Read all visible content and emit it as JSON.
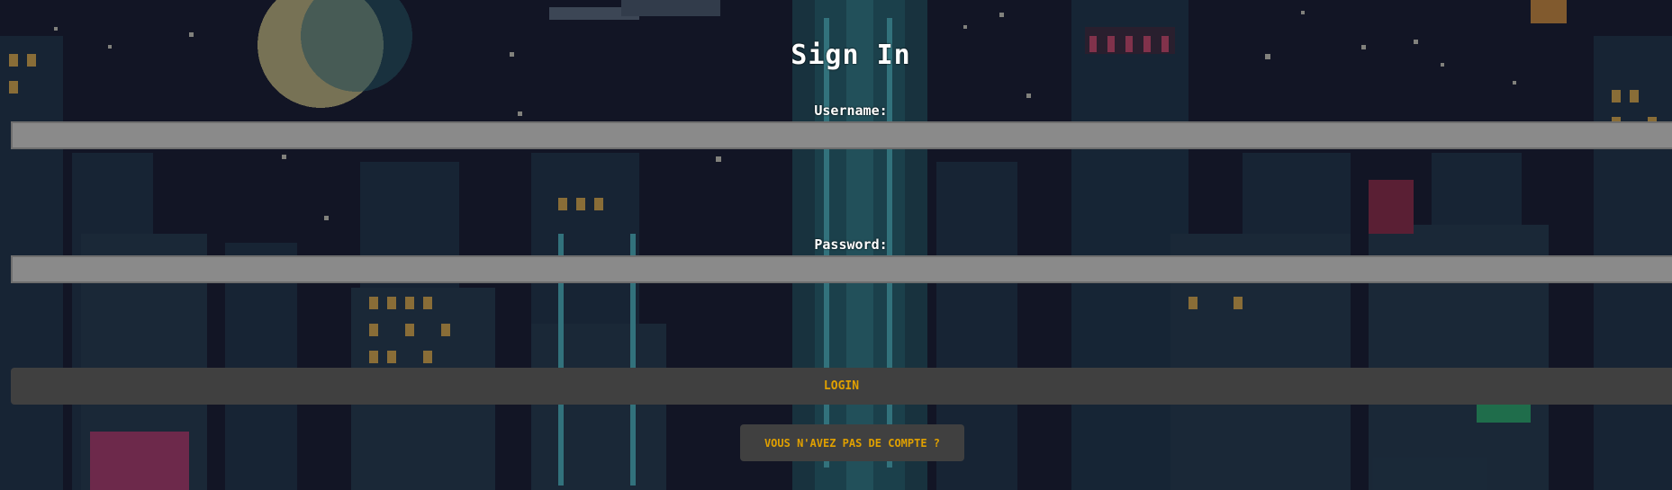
{
  "signin": {
    "title": "Sign In",
    "username_label": "Username:",
    "username_value": "",
    "password_label": "Password:",
    "password_value": "",
    "login_label": "LOGIN",
    "register_label": "VOUS N'AVEZ PAS DE COMPTE ?"
  },
  "colors": {
    "background": "#141727",
    "field": "#8a8a8a",
    "button": "#404040",
    "button_text": "#e0a000"
  }
}
